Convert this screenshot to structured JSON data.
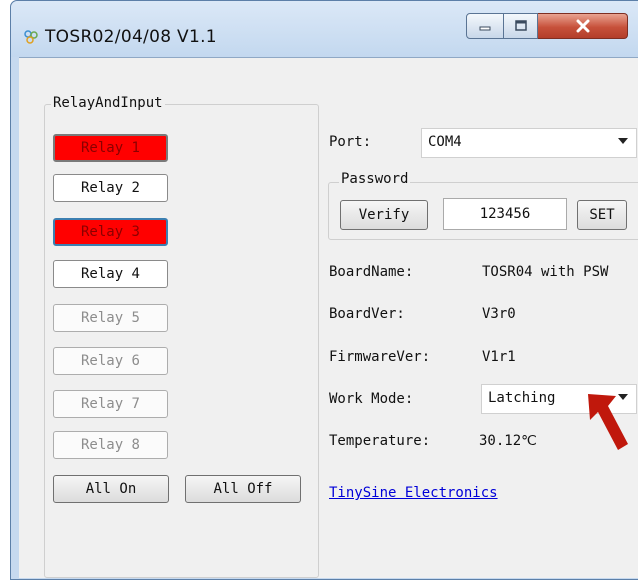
{
  "window": {
    "title": "TOSR02/04/08  V1.1",
    "buttons": {
      "minimize_icon": "minimize-icon",
      "maximize_icon": "maximize-icon",
      "close_icon": "close-icon"
    }
  },
  "relay_group": {
    "label": "RelayAndInput",
    "relays": [
      {
        "label": "Relay 1",
        "state": "on"
      },
      {
        "label": "Relay 2",
        "state": "off"
      },
      {
        "label": "Relay 3",
        "state": "on"
      },
      {
        "label": "Relay 4",
        "state": "off"
      },
      {
        "label": "Relay 5",
        "state": "disabled"
      },
      {
        "label": "Relay 6",
        "state": "disabled"
      },
      {
        "label": "Relay 7",
        "state": "disabled"
      },
      {
        "label": "Relay 8",
        "state": "disabled"
      }
    ],
    "all_on_label": "All On",
    "all_off_label": "All Off"
  },
  "port": {
    "label": "Port:",
    "value": "COM4"
  },
  "password": {
    "group_label": "Password",
    "verify_label": "Verify",
    "value": "123456",
    "set_label": "SET"
  },
  "info": {
    "board_name_label": "BoardName:",
    "board_name_value": "TOSR04 with PSW",
    "board_ver_label": "BoardVer:",
    "board_ver_value": "V3r0",
    "firmware_ver_label": "FirmwareVer:",
    "firmware_ver_value": "V1r1",
    "work_mode_label": "Work Mode:",
    "work_mode_value": "Latching",
    "temperature_label": "Temperature:",
    "temperature_value": "30.12℃"
  },
  "link_text": "TinySine Electronics",
  "colors": {
    "relay_on": "#ff0000",
    "link": "#0000d8",
    "annotation_arrow": "#c0180c"
  }
}
